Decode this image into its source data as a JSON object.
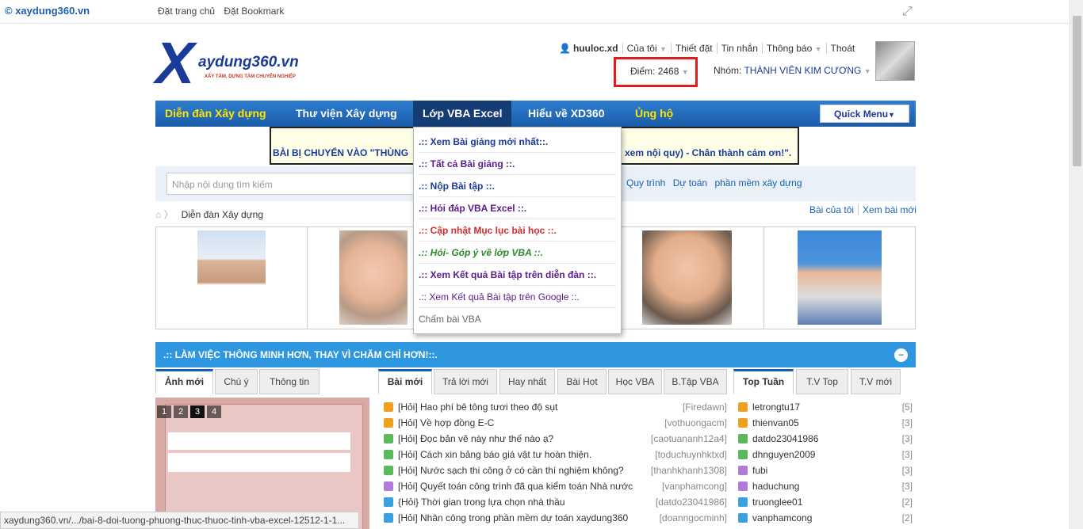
{
  "topbar": {
    "brand": "© xaydung360.vn",
    "links": [
      "Đặt trang chủ",
      "Đặt Bookmark"
    ]
  },
  "logo": {
    "name": "aydung360.vn",
    "tagline": "XÂY TÂM, DỰNG TẦM CHUYÊN NGHIỆP"
  },
  "user_nav": {
    "username": "huuloc.xd",
    "items": [
      "Của tôi",
      "Thiết đặt",
      "Tin nhắn",
      "Thông báo",
      "Thoát"
    ]
  },
  "points": {
    "label": "Điểm:",
    "value": "2468"
  },
  "group": {
    "label": "Nhóm:",
    "value": "THÀNH VIÊN KIM CƯƠNG"
  },
  "main_nav": {
    "items": [
      "Diễn đàn Xây dựng",
      "Thư viện Xây dựng",
      "Lớp VBA Excel",
      "Hiểu về XD360",
      "Ủng hộ"
    ],
    "quick_menu": "Quick Menu"
  },
  "notice": {
    "left": "BÀI BỊ CHUYỂN VÀO \"THÙNG",
    "right": "xem nội quy) - Chân thành cảm ơn!\"."
  },
  "search": {
    "placeholder": "Nhập nội dung tìm kiếm",
    "tags": [
      "Quy trình",
      "Dự toán",
      "phần mềm xây dựng"
    ]
  },
  "breadcrumb": {
    "current": "Diễn đàn Xây dựng",
    "right": [
      "Bài của tôi",
      "Xem bài mới"
    ]
  },
  "dropdown": {
    "items": [
      ".:: Xem Bài giảng mới nhất::.",
      ".:: Tất cả Bài giảng ::.",
      ".:: Nộp Bài tập ::.",
      ".:: Hỏi đáp VBA Excel ::.",
      ".:: Cập nhật Mục lục bài học ::.",
      ".:: Hỏi- Góp ý về lớp VBA ::.",
      ".:: Xem Kết quả Bài tập trên diễn đàn ::.",
      ".:: Xem Kết quả Bài tập trên Google ::.",
      "Chấm bài VBA"
    ]
  },
  "block": {
    "title": ".:: LÀM VIỆC THÔNG MINH HƠN, THAY VÌ CHĂM CHỈ HƠN!::.",
    "toggle": "−"
  },
  "tabs_left": [
    "Ảnh mới",
    "Chú ý",
    "Thông tin"
  ],
  "tabs_mid": [
    "Bài mới",
    "Trả lời mới",
    "Hay nhất",
    "Bài Hot",
    "Học VBA",
    "B.Tập VBA"
  ],
  "tabs_right": [
    "Top Tuần",
    "T.V Top",
    "T.V mới"
  ],
  "slider_pages": [
    "1",
    "2",
    "3",
    "4"
  ],
  "posts": [
    {
      "title": "[Hỏi] Hao phí bê tông tươi theo độ sụt",
      "user": "[Firedawn]"
    },
    {
      "title": "[Hỏi] Về hợp đồng E-C",
      "user": "[vothuongacm]"
    },
    {
      "title": "[Hỏi] Đọc bản vẽ này như thế nào ạ?",
      "user": "[caotuananh12a4]"
    },
    {
      "title": "[Hỏi] Cách xin bảng báo giá vật tư hoàn thiện.",
      "user": "[toduchuynhktxd]"
    },
    {
      "title": "[Hỏi] Nước sạch thi công ở có cần thí nghiệm không?",
      "user": "[thanhkhanh1308]"
    },
    {
      "title": "[Hỏi] Quyết toán công trình đã qua kiểm toán Nhà nước",
      "user": "[vanphamcong]"
    },
    {
      "title": "{Hỏi} Thời gian trong lựa chọn nhà thầu",
      "user": "[datdo23041986]"
    },
    {
      "title": "[Hỏi] Nhân công trong phần mềm dự toán xaydung360",
      "user": "[doanngocminh]"
    }
  ],
  "top_users": [
    {
      "name": "letrongtu17",
      "count": "[5]"
    },
    {
      "name": "thienvan05",
      "count": "[3]"
    },
    {
      "name": "datdo23041986",
      "count": "[3]"
    },
    {
      "name": "dhnguyen2009",
      "count": "[3]"
    },
    {
      "name": "fubi",
      "count": "[3]"
    },
    {
      "name": "haduchung",
      "count": "[3]"
    },
    {
      "name": "truonglee01",
      "count": "[2]"
    },
    {
      "name": "vanphamcong",
      "count": "[2]"
    }
  ],
  "status_url": "xaydung360.vn/.../bai-8-doi-tuong-phuong-thuc-thuoc-tinh-vba-excel-12512-1-1...",
  "colors": {
    "nav_blue": "#1a5ca8",
    "highlight_red": "#e01b1b",
    "block_blue": "#2e97e0"
  }
}
